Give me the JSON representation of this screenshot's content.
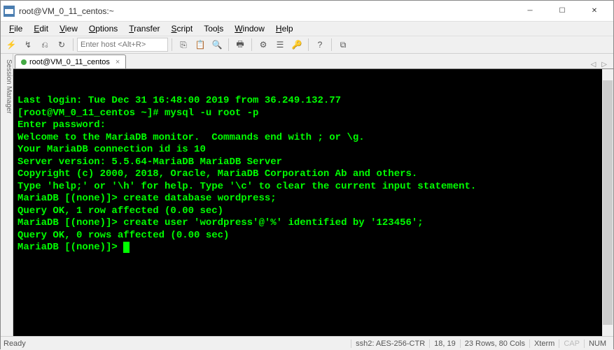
{
  "window": {
    "title": "root@VM_0_11_centos:~"
  },
  "menu": {
    "file": "File",
    "edit": "Edit",
    "view": "View",
    "options": "Options",
    "transfer": "Transfer",
    "script": "Script",
    "tools": "Tools",
    "window": "Window",
    "help": "Help"
  },
  "toolbar": {
    "host_placeholder": "Enter host <Alt+R>"
  },
  "side": {
    "label": "Session Manager"
  },
  "tab": {
    "label": "root@VM_0_11_centos"
  },
  "terminal": {
    "lines": [
      "Last login: Tue Dec 31 16:48:00 2019 from 36.249.132.77",
      "[root@VM_0_11_centos ~]# mysql -u root -p",
      "Enter password: ",
      "Welcome to the MariaDB monitor.  Commands end with ; or \\g.",
      "Your MariaDB connection id is 10",
      "Server version: 5.5.64-MariaDB MariaDB Server",
      "",
      "Copyright (c) 2000, 2018, Oracle, MariaDB Corporation Ab and others.",
      "",
      "Type 'help;' or '\\h' for help. Type '\\c' to clear the current input statement.",
      "",
      "MariaDB [(none)]> create database wordpress;",
      "Query OK, 1 row affected (0.00 sec)",
      "",
      "MariaDB [(none)]> create user 'wordpress'@'%' identified by '123456';",
      "Query OK, 0 rows affected (0.00 sec)",
      "",
      "MariaDB [(none)]> "
    ]
  },
  "status": {
    "ready": "Ready",
    "cipher": "ssh2: AES-256-CTR",
    "pos": "18,  19",
    "size": "23 Rows, 80 Cols",
    "term": "Xterm",
    "caps": "CAP",
    "num": "NUM"
  }
}
